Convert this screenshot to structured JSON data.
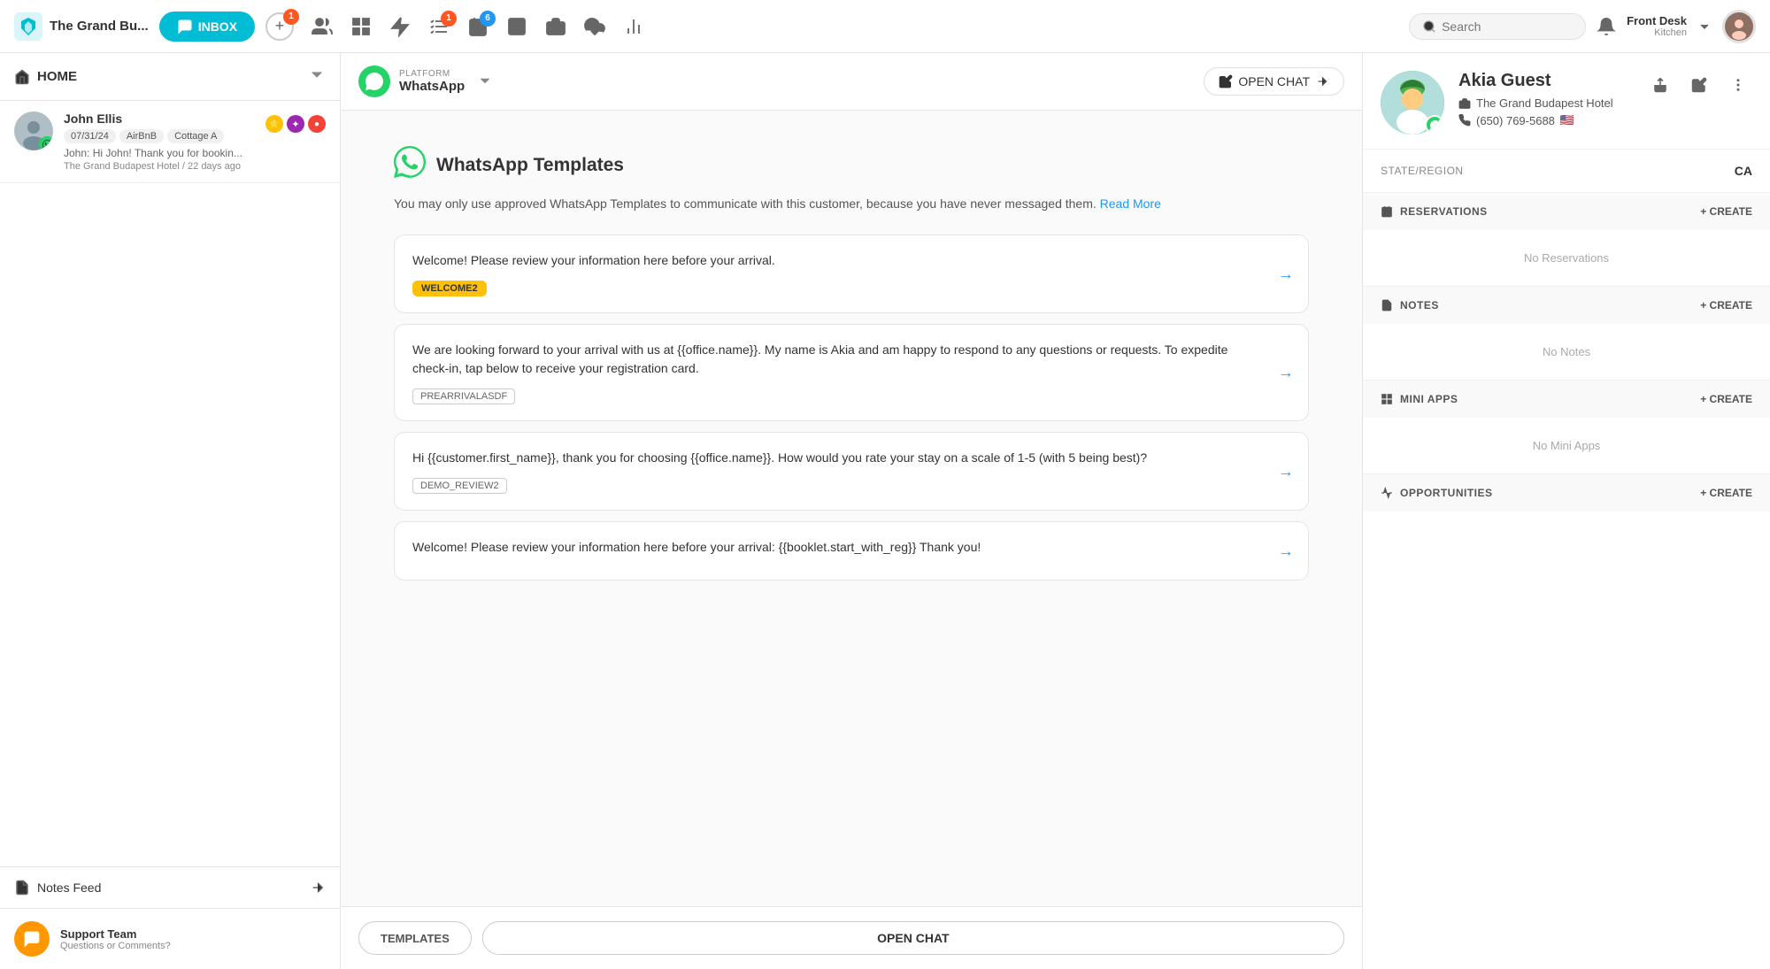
{
  "app": {
    "name": "The Grand Bu...",
    "logo_color": "#00bcd4"
  },
  "topnav": {
    "inbox_label": "INBOX",
    "add_btn": "+",
    "search_placeholder": "Search",
    "user_name": "Front Desk",
    "user_role": "Kitchen",
    "badges": {
      "conversations": "1",
      "tasks": "1",
      "notifications": "6"
    }
  },
  "sidebar": {
    "home_label": "HOME",
    "contact": {
      "name": "John Ellis",
      "date": "07/31/24",
      "tag1": "AirBnB",
      "tag2": "Cottage A",
      "preview": "John: Hi John! Thank you for bookin...",
      "hotel": "The Grand Budapest Hotel / 22 days ago"
    },
    "notes_feed_label": "Notes Feed",
    "support_name": "Support Team",
    "support_desc": "Questions or Comments?"
  },
  "chat": {
    "platform_label": "PLATFORM",
    "platform_name": "WhatsApp",
    "open_chat_btn": "OPEN CHAT",
    "templates_heading": "WhatsApp Templates",
    "templates_desc": "You may only use approved WhatsApp Templates to communicate with this customer, because you have never messaged them.",
    "read_more": "Read More",
    "templates": [
      {
        "text": "Welcome! Please review your information here before your arrival.",
        "badge": "WELCOME2",
        "badge_type": "filled"
      },
      {
        "text": "We are looking forward to your arrival with us at {{office.name}}. My name is Akia and am happy to respond to any questions or requests. To expedite check-in, tap below to receive your registration card.",
        "badge": "PREARRIVALASDF",
        "badge_type": "outline"
      },
      {
        "text": "Hi {{customer.first_name}}, thank you for choosing {{office.name}}. How would you rate your stay on a scale of 1-5 (with 5 being best)?",
        "badge": "DEMO_REVIEW2",
        "badge_type": "outline"
      },
      {
        "text": "Welcome! Please review your information here before your arrival: {{booklet.start_with_reg}} Thank you!",
        "badge": "",
        "badge_type": "none"
      }
    ],
    "footer_templates": "TEMPLATES",
    "footer_open_chat": "OPEN CHAT"
  },
  "right_panel": {
    "contact_name": "Akia Guest",
    "hotel": "The Grand Budapest Hotel",
    "phone": "(650) 769-5688",
    "flag": "🇺🇸",
    "state_label": "STATE/REGION",
    "state_value": "CA",
    "reservations_label": "RESERVATIONS",
    "reservations_create": "+ CREATE",
    "reservations_empty": "No Reservations",
    "notes_label": "NOTES",
    "notes_create": "+ CREATE",
    "notes_empty": "No Notes",
    "mini_apps_label": "MINI APPS",
    "mini_apps_create": "+ CREATE",
    "mini_apps_empty": "No Mini Apps",
    "opportunities_label": "OPPORTUNITIES",
    "opportunities_create": "+ CREATE"
  }
}
